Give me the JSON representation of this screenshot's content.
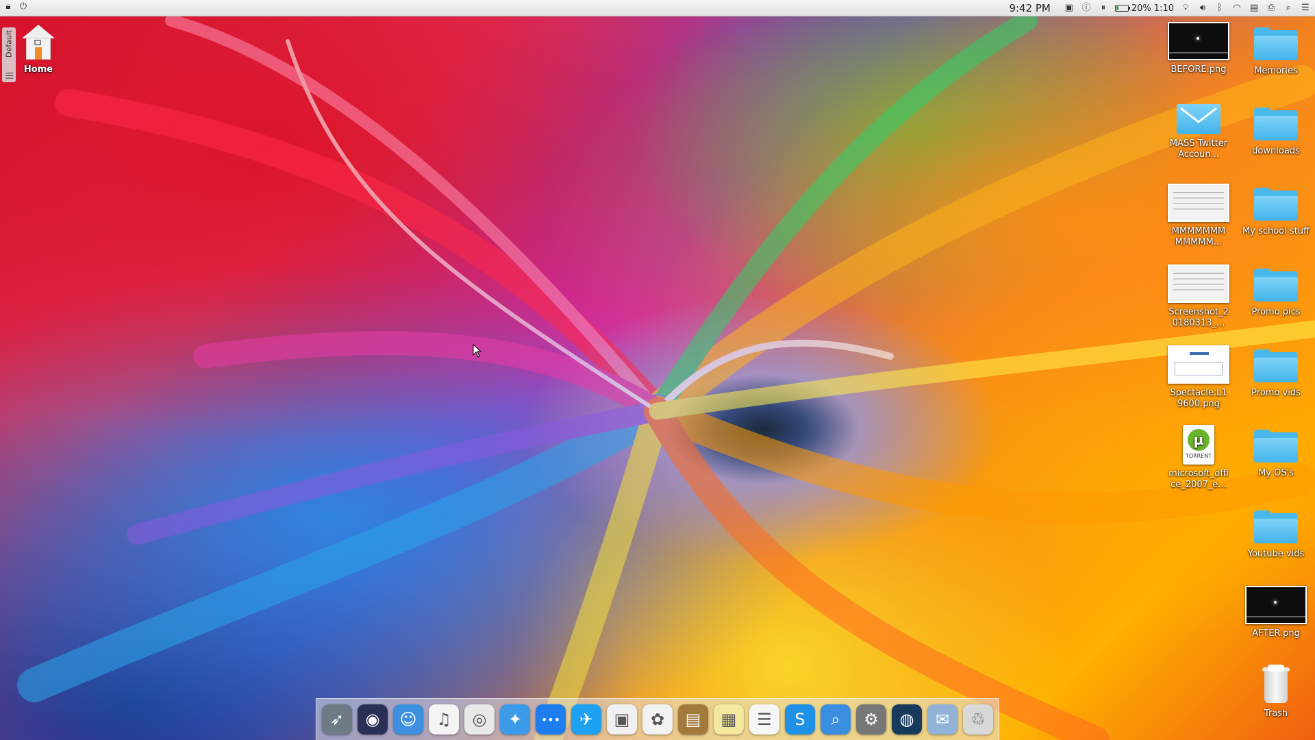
{
  "menubar": {
    "time": "9:42 PM",
    "battery_percent_label": "20%",
    "battery_time": "1:10",
    "battery_level": 0.2
  },
  "side_tab": {
    "label": "Default"
  },
  "desktop": {
    "home": {
      "label": "Home"
    },
    "right_icons": [
      {
        "label": "BEFORE.png",
        "kind": "thumb-dark"
      },
      {
        "label": "Memories",
        "kind": "folder"
      },
      {
        "label": "MASS Twitter Accoun...",
        "kind": "mail"
      },
      {
        "label": "downloads",
        "kind": "folder"
      },
      {
        "label": "MMMMMMM MMMMM...",
        "kind": "thumb-light"
      },
      {
        "label": "My school stuff",
        "kind": "folder"
      },
      {
        "label": "Screenshot_2 0180313_...",
        "kind": "thumb-light"
      },
      {
        "label": "Promo pics",
        "kind": "folder"
      },
      {
        "label": "Spectacle.L1 9600.png",
        "kind": "thumb-doc"
      },
      {
        "label": "Promo vids",
        "kind": "folder"
      },
      {
        "label": "microsoft_offi ce_2007_e...",
        "kind": "torrent"
      },
      {
        "label": "My OS's",
        "kind": "folder"
      },
      {
        "label": "Youtube vids",
        "kind": "folder"
      },
      {
        "label": "AFTER.png",
        "kind": "thumb-dark"
      },
      {
        "label": "Trash",
        "kind": "trash"
      }
    ],
    "torrent_badge": "TORRENT"
  },
  "dock": {
    "items": [
      {
        "name": "launchpad-rocket-icon",
        "glyph": "➶",
        "color": "#6e7a86"
      },
      {
        "name": "siri-icon",
        "glyph": "◉",
        "color": "#2a2f55"
      },
      {
        "name": "finder-icon",
        "glyph": "☺",
        "color": "#3d8fe0"
      },
      {
        "name": "itunes-music-icon",
        "glyph": "♫",
        "color": "#f4f4f4"
      },
      {
        "name": "chrome-icon",
        "glyph": "◎",
        "color": "#e9e9e9"
      },
      {
        "name": "safari-compass-icon",
        "glyph": "✦",
        "color": "#3b9be8"
      },
      {
        "name": "messages-dots-icon",
        "glyph": "•••",
        "color": "#1e7ef0"
      },
      {
        "name": "twitter-bird-icon",
        "glyph": "✈",
        "color": "#1da1f2"
      },
      {
        "name": "photo-viewer-icon",
        "glyph": "▣",
        "color": "#f0f0f0"
      },
      {
        "name": "photos-flower-icon",
        "glyph": "✿",
        "color": "#f2f2f2"
      },
      {
        "name": "contacts-book-icon",
        "glyph": "▤",
        "color": "#a27a3c"
      },
      {
        "name": "notes-icon",
        "glyph": "▦",
        "color": "#f4e7a0"
      },
      {
        "name": "reminders-list-icon",
        "glyph": "☰",
        "color": "#f6f6f6"
      },
      {
        "name": "skype-icon",
        "glyph": "S",
        "color": "#1e90e8"
      },
      {
        "name": "preview-magnifier-icon",
        "glyph": "⌕",
        "color": "#3a8ee0"
      },
      {
        "name": "system-preferences-gear-icon",
        "glyph": "⚙",
        "color": "#777"
      },
      {
        "name": "steam-icon",
        "glyph": "◍",
        "color": "#173a5a"
      },
      {
        "name": "mail-stamp-icon",
        "glyph": "✉",
        "color": "#8fb2d6"
      },
      {
        "name": "dock-trash-icon",
        "glyph": "♲",
        "color": "#d8d8d8"
      }
    ]
  }
}
